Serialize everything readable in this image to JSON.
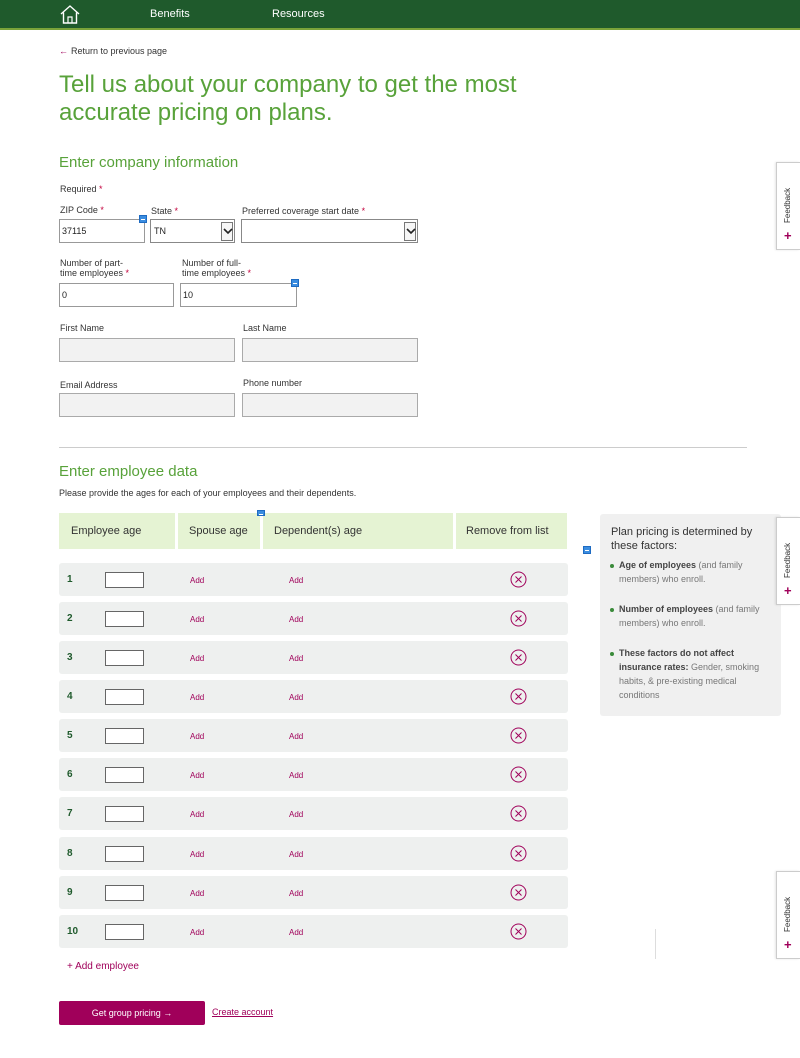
{
  "nav": {
    "home_icon": "house-icon",
    "links": [
      "Benefits",
      "Resources"
    ],
    "colors": {
      "bar": "#1f5a2c",
      "accent": "#7aa33a"
    }
  },
  "back_link": {
    "arrow": "←",
    "label": "Return to previous page"
  },
  "headline": "Tell us about your company to get the most accurate pricing on plans.",
  "company": {
    "title": "Enter company information",
    "required_note": "Required",
    "zip": {
      "label": "ZIP Code",
      "value": "37115"
    },
    "state": {
      "label": "State",
      "value": "TN"
    },
    "coverage": {
      "label": "Preferred coverage start date",
      "value": ""
    },
    "part_time": {
      "label_line1": "Number of part-",
      "label_line2": "time employees",
      "value": "0"
    },
    "full_time": {
      "label_line1": "Number of full-",
      "label_line2": "time employees",
      "value": "10"
    },
    "first_name": {
      "label": "First Name",
      "value": ""
    },
    "last_name": {
      "label": "Last Name",
      "value": ""
    },
    "email": {
      "label": "Email Address",
      "value": ""
    },
    "phone": {
      "label": "Phone number",
      "value": ""
    },
    "required_marker": "*"
  },
  "employees": {
    "title": "Enter employee data",
    "subtitle": "Please provide the ages for each of your employees and their dependents.",
    "headers": [
      "Employee age",
      "Spouse age",
      "Dependent(s) age",
      "Remove from list"
    ],
    "rows": [
      {
        "num": "1",
        "age": "",
        "spouse": "Add",
        "dependents": "Add"
      },
      {
        "num": "2",
        "age": "",
        "spouse": "Add",
        "dependents": "Add"
      },
      {
        "num": "3",
        "age": "",
        "spouse": "Add",
        "dependents": "Add"
      },
      {
        "num": "4",
        "age": "",
        "spouse": "Add",
        "dependents": "Add"
      },
      {
        "num": "5",
        "age": "",
        "spouse": "Add",
        "dependents": "Add"
      },
      {
        "num": "6",
        "age": "",
        "spouse": "Add",
        "dependents": "Add"
      },
      {
        "num": "7",
        "age": "",
        "spouse": "Add",
        "dependents": "Add"
      },
      {
        "num": "8",
        "age": "",
        "spouse": "Add",
        "dependents": "Add"
      },
      {
        "num": "9",
        "age": "",
        "spouse": "Add",
        "dependents": "Add"
      },
      {
        "num": "10",
        "age": "",
        "spouse": "Add",
        "dependents": "Add"
      }
    ],
    "remove_icon": "circle-x-icon",
    "add_employee": "+ Add employee"
  },
  "info": {
    "title": "Plan pricing is determined by these factors:",
    "items": [
      {
        "bold": "Age of employees",
        "rest": " (and family members) who enroll."
      },
      {
        "bold": "Number of employees",
        "rest": " (and family members) who enroll."
      },
      {
        "bold": "These factors do not affect insurance rates:",
        "rest": " Gender, smoking habits, & pre-existing medical conditions"
      }
    ]
  },
  "actions": {
    "get_pricing": "Get group pricing →",
    "create_account": "Create account"
  },
  "feedback": {
    "label": "Feedback",
    "plus": "+"
  },
  "brand_colors": {
    "green": "#58a23a",
    "magenta": "#a0005a",
    "table_head": "#e5f3d3"
  }
}
